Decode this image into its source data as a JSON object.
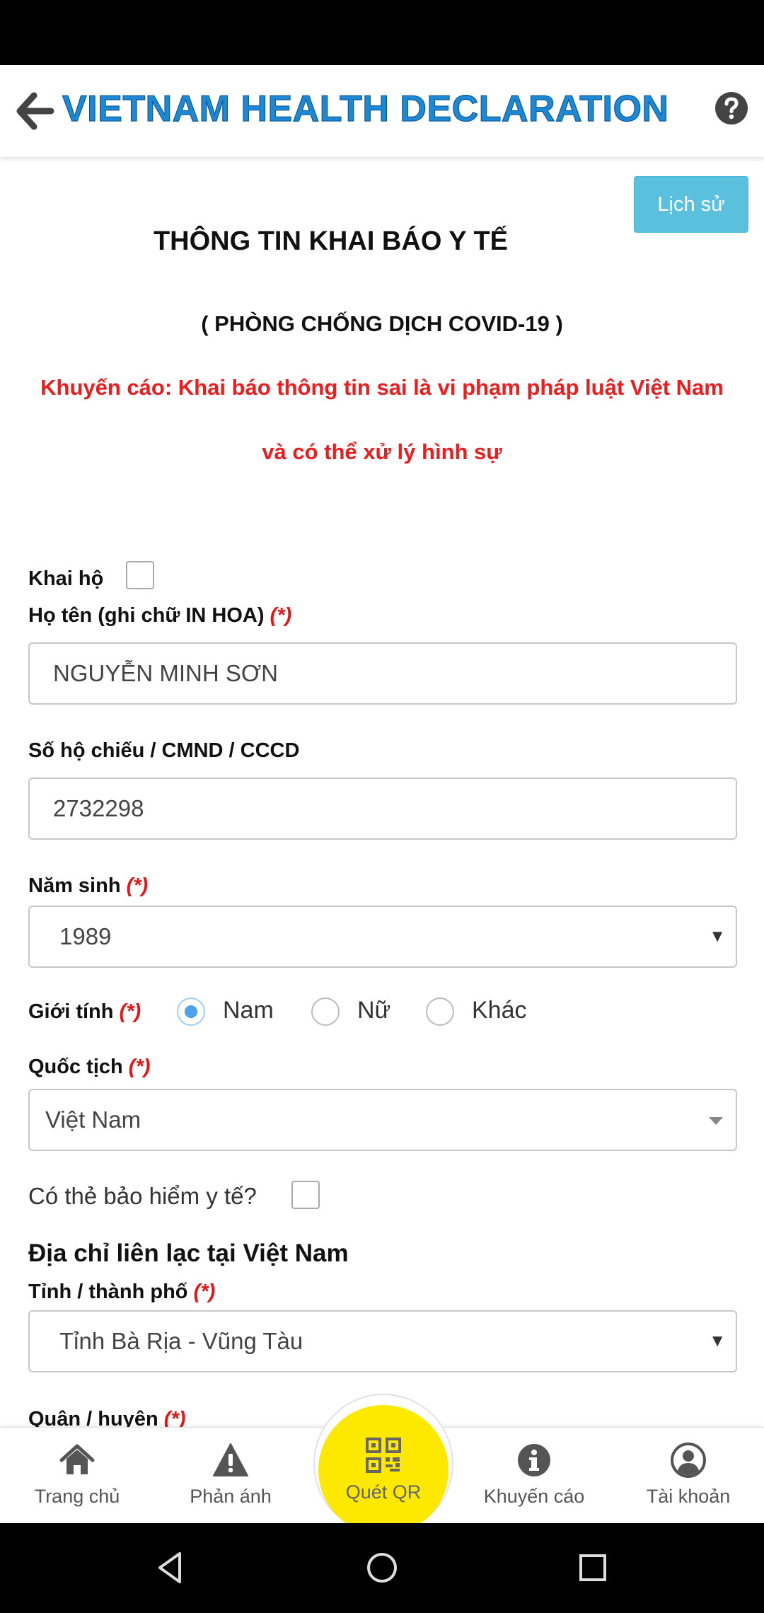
{
  "header": {
    "title": "VIETNAM HEALTH DECLARATION"
  },
  "history_button": "Lịch sử",
  "form": {
    "title": "THÔNG TIN KHAI BÁO Y TẾ",
    "subtitle": "( PHÒNG CHỐNG DỊCH COVID-19 )",
    "warning_line1": "Khuyến cáo: Khai báo thông tin sai là vi phạm pháp luật Việt Nam",
    "warning_line2": "và có thể xử lý hình sự",
    "required_mark": "(*)",
    "on_behalf": {
      "label": "Khai hộ",
      "checked": false
    },
    "full_name": {
      "label": "Họ tên (ghi chữ IN HOA)",
      "value": "NGUYỄN MINH SƠN"
    },
    "id_number": {
      "label": "Số hộ chiếu / CMND / CCCD",
      "value": "2732298"
    },
    "birth_year": {
      "label": "Năm sinh",
      "value": "1989"
    },
    "gender": {
      "label": "Giới tính",
      "options": [
        "Nam",
        "Nữ",
        "Khác"
      ],
      "selected": "Nam"
    },
    "nationality": {
      "label": "Quốc tịch",
      "value": "Việt Nam"
    },
    "insurance": {
      "label": "Có thẻ bảo hiểm y tế?",
      "checked": false
    },
    "address_heading": "Địa chỉ liên lạc tại Việt Nam",
    "province": {
      "label": "Tỉnh / thành phố",
      "value": "Tỉnh Bà Rịa - Vũng Tàu"
    },
    "district": {
      "label": "Quận / huyện"
    }
  },
  "bottom_nav": {
    "home": "Trang chủ",
    "feedback": "Phản ánh",
    "scan_qr": "Quét QR",
    "advice": "Khuyến cáo",
    "account": "Tài khoản"
  },
  "colors": {
    "title_blue": "#1e88d4",
    "history_button": "#5bc0de",
    "warning_red": "#ee1c1c",
    "qr_yellow": "#fde900",
    "radio_selected": "#4aa3ec"
  }
}
